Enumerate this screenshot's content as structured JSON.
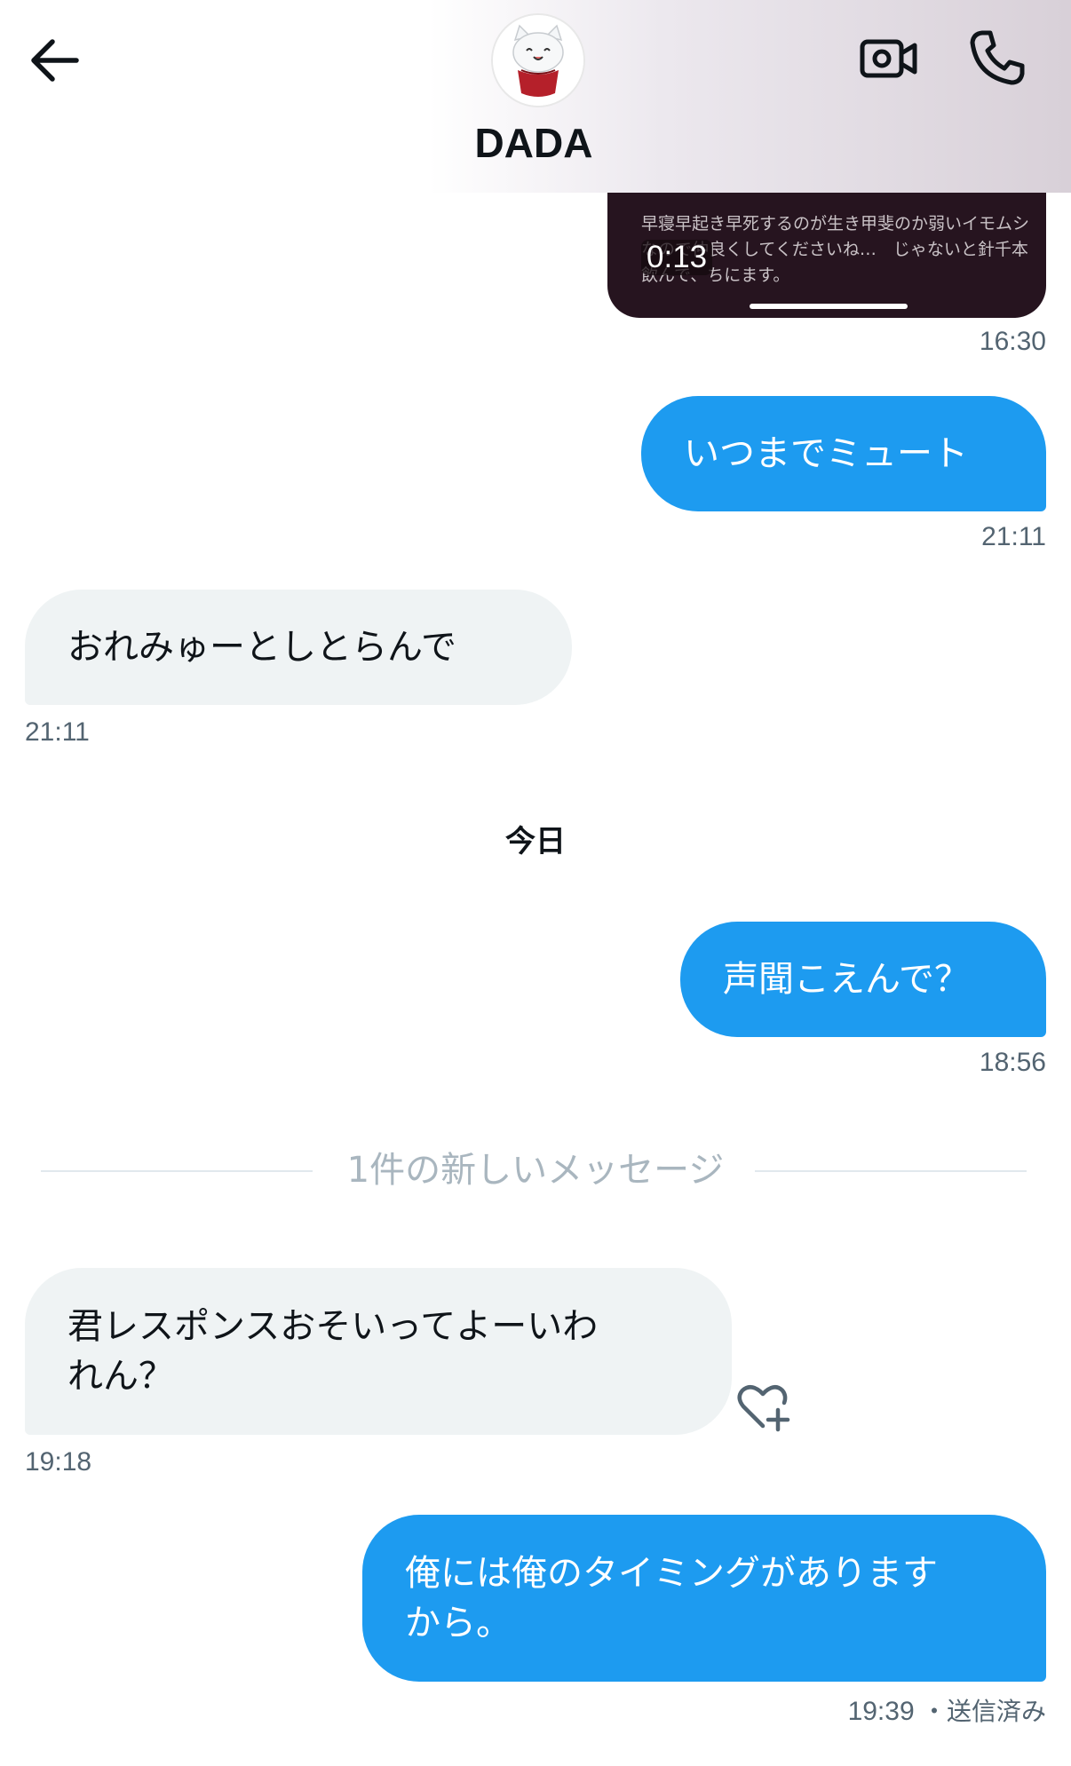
{
  "header": {
    "contact_name": "DADA",
    "back_icon": "arrow-left-icon",
    "video_icon": "video-camera-icon",
    "call_icon": "phone-icon"
  },
  "video_message": {
    "caption": "早寝早起き早死するのが生き甲斐のか弱いイモムシなので仲良くしてくださいね…　じゃないと針千本飲んで、ちにます。",
    "duration": "0:13",
    "time": "16:30"
  },
  "messages": [
    {
      "direction": "out",
      "text": "いつまでミュート",
      "time": "21:11"
    },
    {
      "direction": "in",
      "text": "おれみゅーとしとらんで",
      "time": "21:11"
    }
  ],
  "day_separator": "今日",
  "messages_today": [
    {
      "direction": "out",
      "text": "声聞こえんで？",
      "time": "18:56"
    }
  ],
  "new_messages_divider": "1件の新しいメッセージ",
  "messages_new": [
    {
      "direction": "in",
      "line1": "君レスポンスおそいってよーいわ",
      "line2": "れん？",
      "time": "19:18",
      "reaction_icon": "heart-plus-icon"
    },
    {
      "direction": "out",
      "line1": "俺には俺のタイミングがあります",
      "line2": "から。",
      "time": "19:39",
      "status": "・送信済み"
    }
  ],
  "colors": {
    "outgoing_bubble": "#1d9bf0",
    "incoming_bubble": "#eff3f4",
    "timestamp": "#536471",
    "divider_text": "#a9b6bf"
  }
}
